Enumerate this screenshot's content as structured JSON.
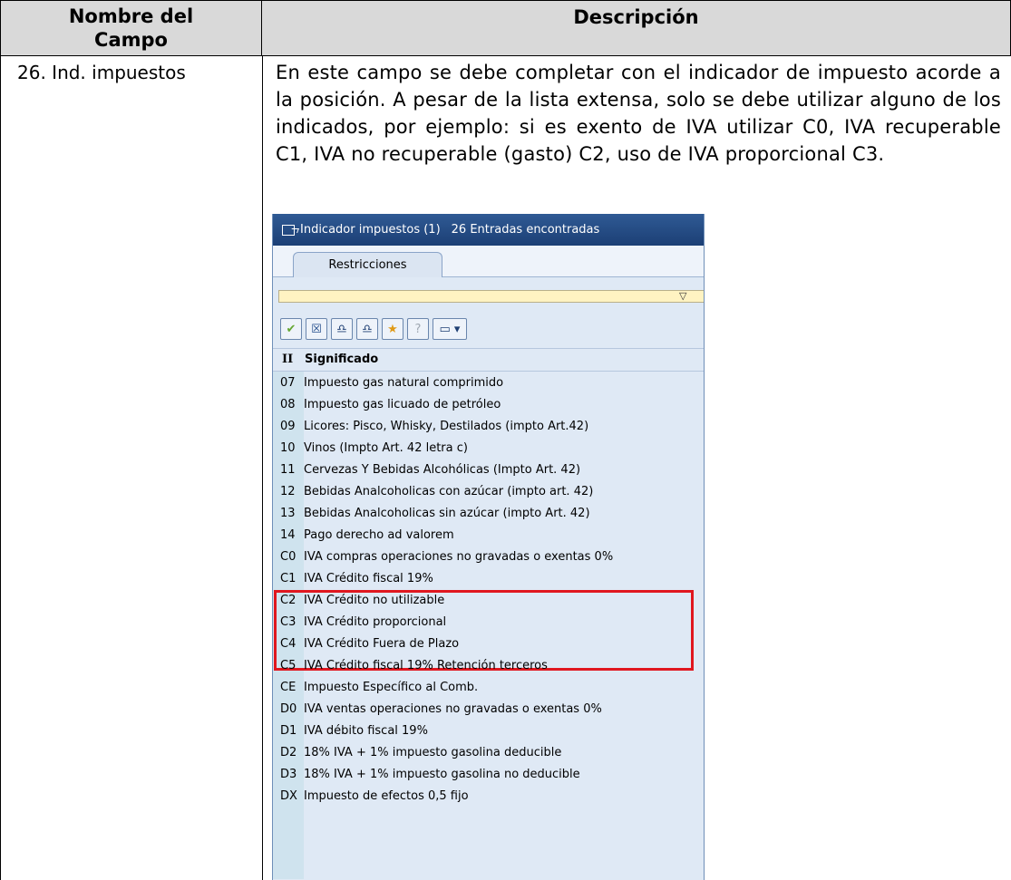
{
  "table": {
    "header_left_line1": "Nombre del",
    "header_left_line2": "Campo",
    "header_right": "Descripción",
    "field_name": "26. Ind. impuestos",
    "description": "En este campo se debe completar con el indicador de impuesto acorde a la posición. A pesar de la lista extensa, solo se debe utilizar alguno de los indicados, por ejemplo: si es exento de IVA utilizar C0, IVA recuperable C1, IVA no recuperable (gasto) C2, uso de IVA proporcional C3."
  },
  "popup": {
    "title": "Indicador impuestos (1)",
    "entries": "26 Entradas encontradas",
    "tab": "Restricciones",
    "col_key": "II",
    "col_meaning": "Significado",
    "rows": [
      {
        "k": "07",
        "v": "Impuesto gas natural comprimido"
      },
      {
        "k": "08",
        "v": "Impuesto gas licuado de petróleo"
      },
      {
        "k": "09",
        "v": "Licores: Pisco, Whisky, Destilados (impto Art.42)"
      },
      {
        "k": "10",
        "v": "Vinos (Impto Art. 42 letra c)"
      },
      {
        "k": "11",
        "v": "Cervezas Y Bebidas Alcohólicas (Impto Art. 42)"
      },
      {
        "k": "12",
        "v": "Bebidas Analcoholicas con azúcar (impto art. 42)"
      },
      {
        "k": "13",
        "v": "Bebidas Analcoholicas sin azúcar (impto Art. 42)"
      },
      {
        "k": "14",
        "v": "Pago derecho ad valorem"
      },
      {
        "k": "C0",
        "v": "IVA compras operaciones no gravadas o exentas 0%"
      },
      {
        "k": "C1",
        "v": "IVA Crédito fiscal 19%"
      },
      {
        "k": "C2",
        "v": "IVA Crédito no utilizable"
      },
      {
        "k": "C3",
        "v": "IVA Crédito proporcional"
      },
      {
        "k": "C4",
        "v": "IVA Crédito Fuera de Plazo"
      },
      {
        "k": "C5",
        "v": "IVA Crédito fiscal 19% Retención terceros"
      },
      {
        "k": "CE",
        "v": "Impuesto Específico al Comb."
      },
      {
        "k": "D0",
        "v": "IVA ventas operaciones no gravadas o exentas 0%"
      },
      {
        "k": "D1",
        "v": "IVA débito fiscal 19%"
      },
      {
        "k": "D2",
        "v": "18% IVA + 1% impuesto gasolina deducible"
      },
      {
        "k": "D3",
        "v": "18% IVA + 1% impuesto gasolina no deducible"
      },
      {
        "k": "DX",
        "v": "Impuesto de efectos 0,5 fijo"
      }
    ],
    "highlight_color": "#e0171f"
  }
}
